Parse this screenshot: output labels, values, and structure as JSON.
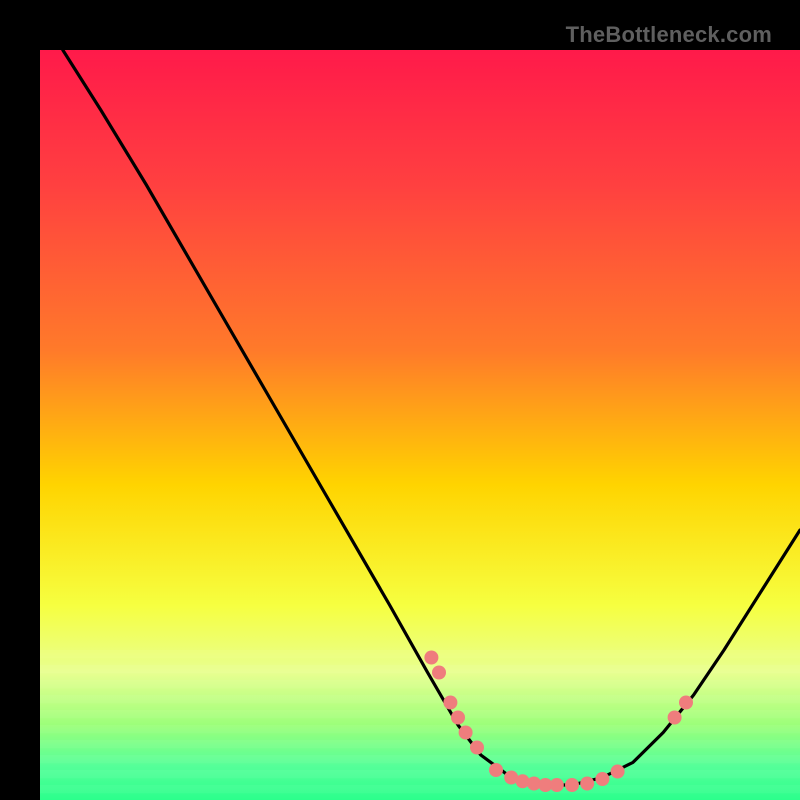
{
  "attribution": "TheBottleneck.com",
  "colors": {
    "top": "#ff1a4a",
    "mid_upper": "#ff7a2a",
    "mid": "#ffd400",
    "mid_lower": "#f6ff40",
    "low_band": "#e8ff90",
    "green_top": "#9cff7a",
    "green": "#2cff8c",
    "curve": "#000000",
    "dot": "#ef7d7d",
    "frame": "#000000"
  },
  "chart_data": {
    "type": "line",
    "title": "",
    "xlabel": "",
    "ylabel": "",
    "x_range": [
      0,
      100
    ],
    "y_range": [
      0,
      100
    ],
    "curve": [
      {
        "x": 3,
        "y": 100
      },
      {
        "x": 8,
        "y": 92
      },
      {
        "x": 14,
        "y": 82
      },
      {
        "x": 22,
        "y": 68
      },
      {
        "x": 30,
        "y": 54
      },
      {
        "x": 38,
        "y": 40
      },
      {
        "x": 46,
        "y": 26
      },
      {
        "x": 51,
        "y": 17
      },
      {
        "x": 55,
        "y": 10
      },
      {
        "x": 58,
        "y": 6
      },
      {
        "x": 62,
        "y": 3
      },
      {
        "x": 66,
        "y": 2
      },
      {
        "x": 70,
        "y": 2
      },
      {
        "x": 74,
        "y": 3
      },
      {
        "x": 78,
        "y": 5
      },
      {
        "x": 82,
        "y": 9
      },
      {
        "x": 86,
        "y": 14
      },
      {
        "x": 90,
        "y": 20
      },
      {
        "x": 95,
        "y": 28
      },
      {
        "x": 100,
        "y": 36
      }
    ],
    "dots": [
      {
        "x": 51.5,
        "y": 19
      },
      {
        "x": 52.5,
        "y": 17
      },
      {
        "x": 54.0,
        "y": 13
      },
      {
        "x": 55.0,
        "y": 11
      },
      {
        "x": 56.0,
        "y": 9
      },
      {
        "x": 57.5,
        "y": 7
      },
      {
        "x": 60.0,
        "y": 4
      },
      {
        "x": 62.0,
        "y": 3
      },
      {
        "x": 63.5,
        "y": 2.5
      },
      {
        "x": 65.0,
        "y": 2.2
      },
      {
        "x": 66.5,
        "y": 2.0
      },
      {
        "x": 68.0,
        "y": 2.0
      },
      {
        "x": 70.0,
        "y": 2.0
      },
      {
        "x": 72.0,
        "y": 2.2
      },
      {
        "x": 74.0,
        "y": 2.8
      },
      {
        "x": 76.0,
        "y": 3.8
      },
      {
        "x": 83.5,
        "y": 11
      },
      {
        "x": 85.0,
        "y": 13
      }
    ]
  }
}
